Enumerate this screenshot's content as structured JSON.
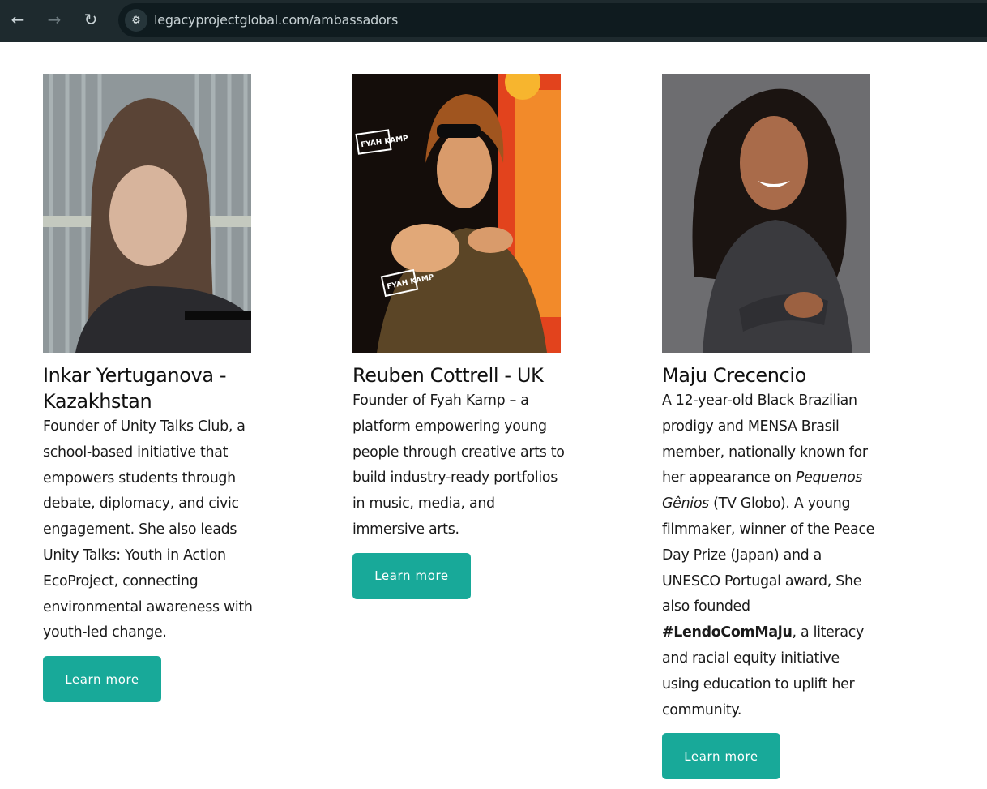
{
  "browser": {
    "back_icon": "arrow-left-icon",
    "forward_icon": "arrow-right-icon",
    "reload_icon": "reload-icon",
    "site_info_icon": "tune-icon",
    "url": "legacyprojectglobal.com/ambassadors"
  },
  "ambassadors": [
    {
      "name": "Inkar Yertuganova - Kazakhstan",
      "description": "Founder of Unity Talks Club, a school-based initiative that empowers students through debate, diplomacy, and civic engagement. She also leads Unity Talks: Youth in Action EcoProject, connecting environmental awareness with youth-led change.",
      "button": "Learn more"
    },
    {
      "name": "Reuben Cottrell - UK",
      "description": "Founder of Fyah Kamp – a platform empowering young people through creative arts to build industry-ready portfolios in music, media, and immersive arts.",
      "button": "Learn more",
      "photo_text": [
        "FYAH KAMP",
        "FYAH KAMP"
      ]
    },
    {
      "name": "Maju Crecencio",
      "description_parts": {
        "p1": "A 12-year-old Black Brazilian prodigy and MENSA Brasil member,  nationally known for her appearance on ",
        "show": "Pequenos Gênios",
        "p2": " (TV Globo). A young filmmaker, winner of the Peace Day Prize (Japan) and a UNESCO Portugal award, She also founded ",
        "hashtag": "#LendoComMaju",
        "p3": ", a literacy and racial equity initiative using education to uplift her community."
      },
      "button": "Learn more"
    }
  ],
  "colors": {
    "accent": "#18a999",
    "topbar": "#1e2a2e",
    "urlbar": "#0f1b1f"
  }
}
